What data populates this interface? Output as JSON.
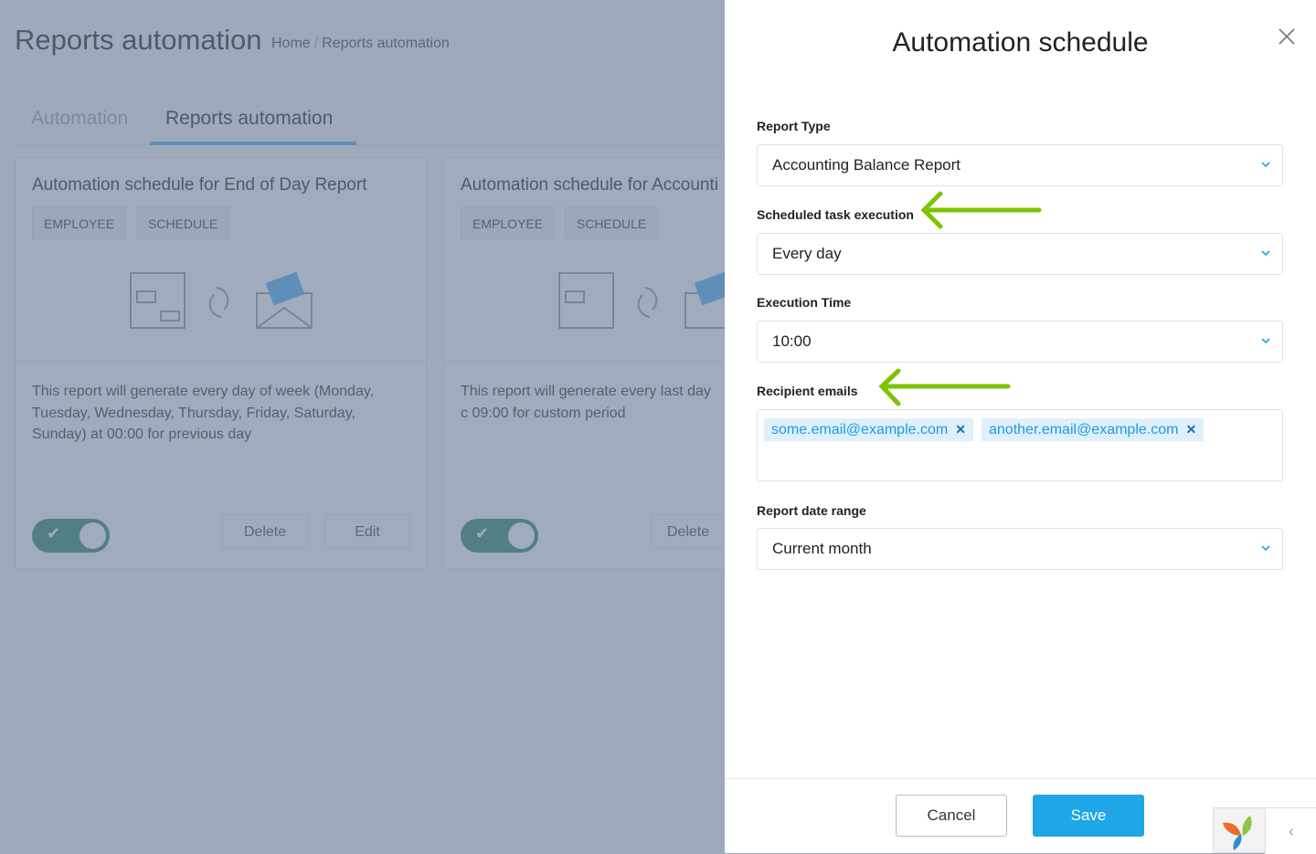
{
  "page": {
    "title": "Reports automation",
    "breadcrumb": [
      "Home",
      "Reports automation"
    ],
    "tabs": [
      {
        "label": "Automation"
      },
      {
        "label": "Reports automation",
        "active": true
      }
    ],
    "cards": [
      {
        "title": "Automation schedule for End of Day Report",
        "chips": [
          "EMPLOYEE",
          "SCHEDULE"
        ],
        "description": "This report will generate every day of week (Monday, Tuesday, Wednesday, Thursday, Friday, Saturday, Sunday) at 00:00 for previous day",
        "enabled": true,
        "delete_label": "Delete",
        "edit_label": "Edit"
      },
      {
        "title": "Automation schedule for Accounti",
        "chips": [
          "EMPLOYEE",
          "SCHEDULE"
        ],
        "description": "This report will generate every last day c 09:00 for custom period",
        "enabled": true,
        "delete_label": "Delete"
      }
    ]
  },
  "panel": {
    "title": "Automation schedule",
    "report_type": {
      "label": "Report Type",
      "value": "Accounting Balance Report"
    },
    "schedule": {
      "label": "Scheduled task execution",
      "value": "Every day"
    },
    "time": {
      "label": "Execution Time",
      "value": "10:00"
    },
    "recipients": {
      "label": "Recipient emails",
      "emails": [
        "some.email@example.com",
        "another.email@example.com"
      ]
    },
    "date_range": {
      "label": "Report date range",
      "value": "Current month"
    },
    "cancel_label": "Cancel",
    "save_label": "Save"
  },
  "colors": {
    "accent": "#1ea6e6",
    "arrow": "#7dc400",
    "toggle": "#27a08c"
  }
}
